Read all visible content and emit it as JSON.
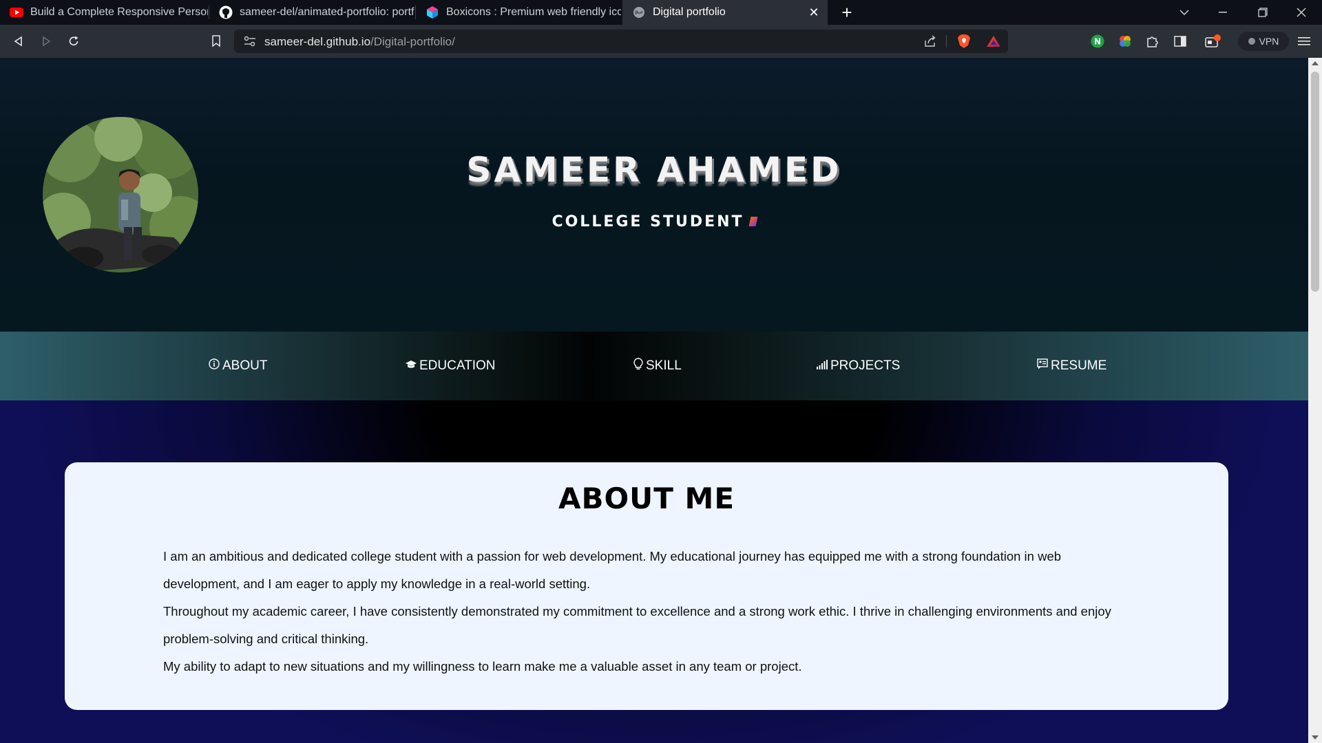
{
  "browser": {
    "tabs": [
      {
        "title": "Build a Complete Responsive Personal",
        "icon": "youtube-icon"
      },
      {
        "title": "sameer-del/animated-portfolio: portfo",
        "icon": "github-icon"
      },
      {
        "title": "Boxicons : Premium web friendly icon",
        "icon": "boxicons-icon"
      },
      {
        "title": "Digital portfolio",
        "icon": "globe-icon",
        "active": true
      }
    ],
    "url_host": "sameer-del.github.io",
    "url_path": "/Digital-portfolio/",
    "vpn_label": "VPN"
  },
  "hero": {
    "name": "SAMEER AHAMED",
    "role": "COLLEGE STUDENT"
  },
  "nav": {
    "items": [
      {
        "label": "ABOUT",
        "icon": "info-circle-icon"
      },
      {
        "label": "EDUCATION",
        "icon": "graduation-cap-icon"
      },
      {
        "label": "SKILL",
        "icon": "bulb-icon"
      },
      {
        "label": "PROJECTS",
        "icon": "signal-bars-icon"
      },
      {
        "label": "RESUME",
        "icon": "resume-icon"
      }
    ]
  },
  "about": {
    "title": "ABOUT ME",
    "paragraphs": [
      "I am an ambitious and dedicated college student with a passion for web development. My educational journey has equipped me with a strong foundation in web development, and I am eager to apply my knowledge in a real-world setting.",
      "Throughout my academic career, I have consistently demonstrated my commitment to excellence and a strong work ethic. I thrive in challenging environments and enjoy problem-solving and critical thinking.",
      "My ability to adapt to new situations and my willingness to learn make me a valuable asset in any team or project."
    ]
  },
  "colors": {
    "hero_bg": "#06161f",
    "nav_edge": "#2e5f69",
    "card_bg": "#eef5ff",
    "main_edge": "#0f0f58"
  }
}
